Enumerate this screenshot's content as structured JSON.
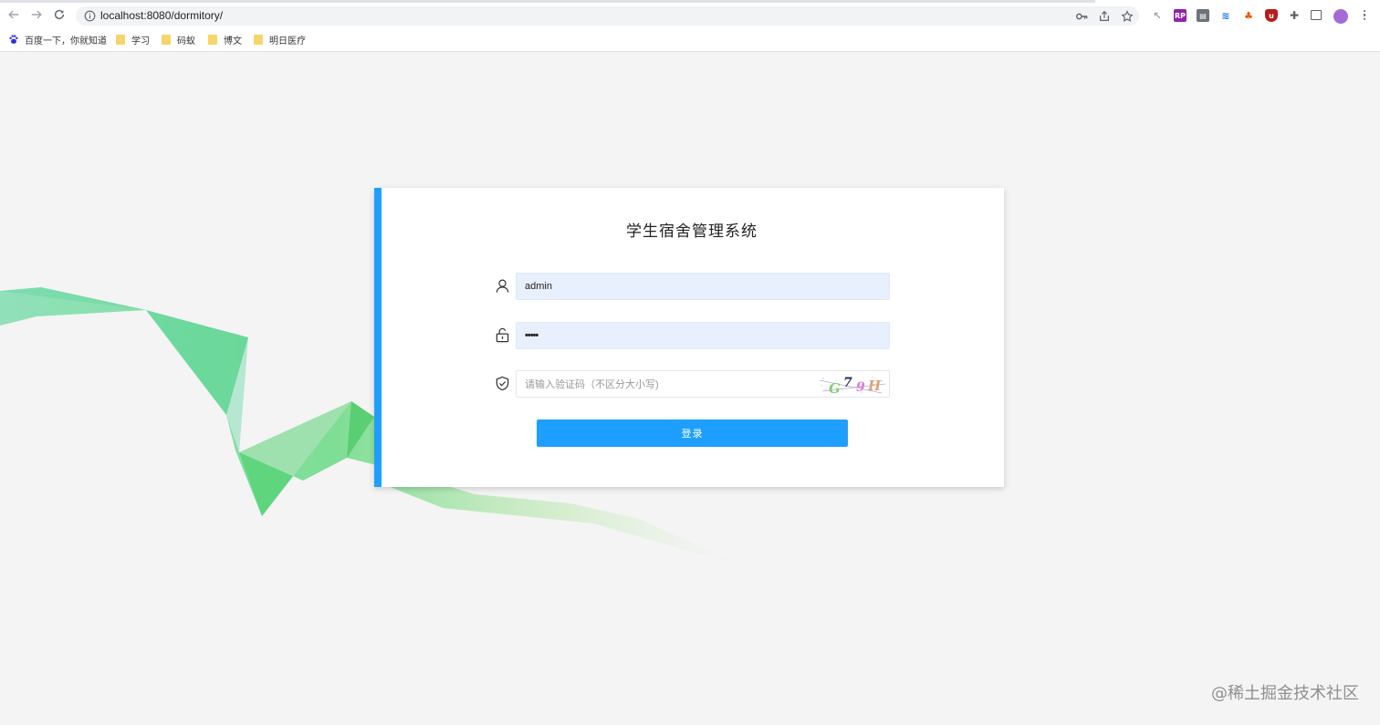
{
  "browser": {
    "url": "localhost:8080/dormitory/",
    "nav": {
      "back_icon": "arrow-left",
      "forward_icon": "arrow-right",
      "reload_icon": "reload"
    },
    "bookmarks": [
      {
        "label": "百度一下，你就知道",
        "icon": "baidu-paw-icon"
      },
      {
        "label": "学习",
        "icon": "folder-icon"
      },
      {
        "label": "码蚁",
        "icon": "folder-icon"
      },
      {
        "label": "博文",
        "icon": "folder-icon"
      },
      {
        "label": "明日医疗",
        "icon": "folder-icon"
      }
    ]
  },
  "login": {
    "title": "学生宿舍管理系统",
    "username_value": "admin",
    "password_value": "•••••",
    "captcha_placeholder": "请输入验证码（不区分大小写)",
    "captcha_text": "G 7 9 H",
    "login_label": "登录"
  },
  "watermark": "@稀土掘金技术社区",
  "colors": {
    "accent": "#1e9fff",
    "autofill": "#e8f0fe",
    "background": "#f4f4f4",
    "wave": "#5fd686"
  }
}
